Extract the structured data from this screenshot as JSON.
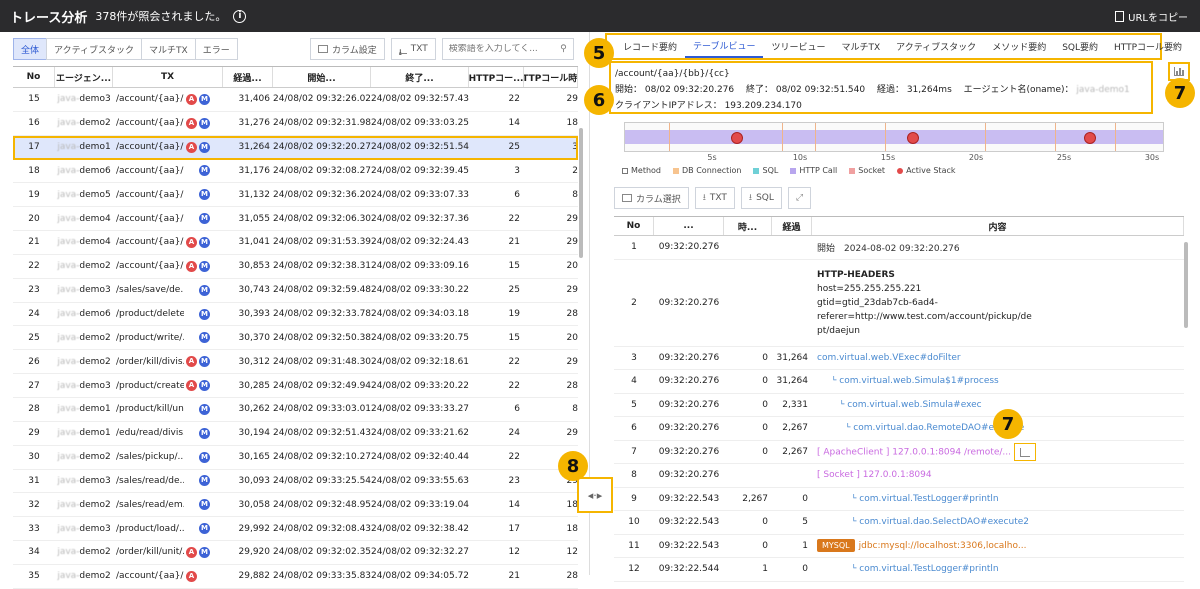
{
  "header": {
    "title": "トレース分析",
    "count_text": "378件が照会されました。",
    "info_icon": "i",
    "copy_label": "URLをコピー"
  },
  "filters": [
    "全体",
    "アクティブスタック",
    "マルチTX",
    "エラー"
  ],
  "left_tools": {
    "column_settings": "カラム設定",
    "txt": "TXT",
    "search_placeholder": "検索語を入力してく..."
  },
  "columns": [
    "No",
    "エージェン...",
    "TX",
    "経過...",
    "開始...",
    "終了...",
    "HTTPコー...",
    "HTTPコール時間"
  ],
  "rows": [
    {
      "no": "15",
      "agent": "demo3",
      "tx": "/account/{aa}/{...",
      "a": true,
      "m": true,
      "elapsed": "31,406",
      "start": "24/08/02 09:32:26.029",
      "end": "24/08/02 09:32:57.435",
      "hc": "22",
      "ht": "29"
    },
    {
      "no": "16",
      "agent": "demo2",
      "tx": "/account/{aa}/{...",
      "a": true,
      "m": true,
      "elapsed": "31,276",
      "start": "24/08/02 09:32:31.982",
      "end": "24/08/02 09:33:03.258",
      "hc": "14",
      "ht": "18"
    },
    {
      "no": "17",
      "agent": "demo1",
      "tx": "/account/{aa}/{...",
      "a": true,
      "m": true,
      "elapsed": "31,264",
      "start": "24/08/02 09:32:20.276",
      "end": "24/08/02 09:32:51.540",
      "hc": "25",
      "ht": "3"
    },
    {
      "no": "18",
      "agent": "demo6",
      "tx": "/account/{aa}/{...",
      "a": false,
      "m": true,
      "elapsed": "31,176",
      "start": "24/08/02 09:32:08.278",
      "end": "24/08/02 09:32:39.454",
      "hc": "3",
      "ht": "2"
    },
    {
      "no": "19",
      "agent": "demo5",
      "tx": "/account/{aa}/{...",
      "a": false,
      "m": true,
      "elapsed": "31,132",
      "start": "24/08/02 09:32:36.202",
      "end": "24/08/02 09:33:07.334",
      "hc": "6",
      "ht": "8"
    },
    {
      "no": "20",
      "agent": "demo4",
      "tx": "/account/{aa}/{...",
      "a": false,
      "m": true,
      "elapsed": "31,055",
      "start": "24/08/02 09:32:06.308",
      "end": "24/08/02 09:32:37.363",
      "hc": "22",
      "ht": "29"
    },
    {
      "no": "21",
      "agent": "demo4",
      "tx": "/account/{aa}/{...",
      "a": true,
      "m": true,
      "elapsed": "31,041",
      "start": "24/08/02 09:31:53.398",
      "end": "24/08/02 09:32:24.439",
      "hc": "21",
      "ht": "29"
    },
    {
      "no": "22",
      "agent": "demo2",
      "tx": "/account/{aa}/{...",
      "a": true,
      "m": true,
      "elapsed": "30,853",
      "start": "24/08/02 09:32:38.313",
      "end": "24/08/02 09:33:09.166",
      "hc": "15",
      "ht": "20"
    },
    {
      "no": "23",
      "agent": "demo3",
      "tx": "/sales/save/de...",
      "a": false,
      "m": true,
      "elapsed": "30,743",
      "start": "24/08/02 09:32:59.481",
      "end": "24/08/02 09:33:30.224",
      "hc": "25",
      "ht": "29"
    },
    {
      "no": "24",
      "agent": "demo6",
      "tx": "/product/delete...",
      "a": false,
      "m": true,
      "elapsed": "30,393",
      "start": "24/08/02 09:32:33.787",
      "end": "24/08/02 09:34:03.180",
      "hc": "19",
      "ht": "28"
    },
    {
      "no": "25",
      "agent": "demo2",
      "tx": "/product/write/...",
      "a": false,
      "m": true,
      "elapsed": "30,370",
      "start": "24/08/02 09:32:50.389",
      "end": "24/08/02 09:33:20.759",
      "hc": "15",
      "ht": "20"
    },
    {
      "no": "26",
      "agent": "demo2",
      "tx": "/order/kill/divis...",
      "a": true,
      "m": true,
      "elapsed": "30,312",
      "start": "24/08/02 09:31:48.304",
      "end": "24/08/02 09:32:18.616",
      "hc": "22",
      "ht": "29"
    },
    {
      "no": "27",
      "agent": "demo3",
      "tx": "/product/create...",
      "a": true,
      "m": true,
      "elapsed": "30,285",
      "start": "24/08/02 09:32:49.944",
      "end": "24/08/02 09:33:20.229",
      "hc": "22",
      "ht": "28"
    },
    {
      "no": "28",
      "agent": "demo1",
      "tx": "/product/kill/un...",
      "a": false,
      "m": true,
      "elapsed": "30,262",
      "start": "24/08/02 09:33:03.011",
      "end": "24/08/02 09:33:33.273",
      "hc": "6",
      "ht": "8"
    },
    {
      "no": "29",
      "agent": "demo1",
      "tx": "/edu/read/divis...",
      "a": false,
      "m": true,
      "elapsed": "30,194",
      "start": "24/08/02 09:32:51.435",
      "end": "24/08/02 09:33:21.629",
      "hc": "24",
      "ht": "29"
    },
    {
      "no": "30",
      "agent": "demo2",
      "tx": "/sales/pickup/...",
      "a": false,
      "m": true,
      "elapsed": "30,165",
      "start": "24/08/02 09:32:10.276",
      "end": "24/08/02 09:32:40.441",
      "hc": "22",
      "ht": "29"
    },
    {
      "no": "31",
      "agent": "demo3",
      "tx": "/sales/read/de...",
      "a": false,
      "m": true,
      "elapsed": "30,093",
      "start": "24/08/02 09:33:25.545",
      "end": "24/08/02 09:33:55.638",
      "hc": "23",
      "ht": "29"
    },
    {
      "no": "32",
      "agent": "demo2",
      "tx": "/sales/read/em...",
      "a": false,
      "m": true,
      "elapsed": "30,058",
      "start": "24/08/02 09:32:48.950",
      "end": "24/08/02 09:33:19.040",
      "hc": "14",
      "ht": "18"
    },
    {
      "no": "33",
      "agent": "demo3",
      "tx": "/product/load/...",
      "a": false,
      "m": true,
      "elapsed": "29,992",
      "start": "24/08/02 09:32:08.434",
      "end": "24/08/02 09:32:38.426",
      "hc": "17",
      "ht": "18"
    },
    {
      "no": "34",
      "agent": "demo2",
      "tx": "/order/kill/unit/...",
      "a": true,
      "m": true,
      "elapsed": "29,920",
      "start": "24/08/02 09:32:02.357",
      "end": "24/08/02 09:32:32.277",
      "hc": "12",
      "ht": "12"
    },
    {
      "no": "35",
      "agent": "demo2",
      "tx": "/account/{aa}/{...",
      "a": true,
      "m": false,
      "elapsed": "29,882",
      "start": "24/08/02 09:33:35.839",
      "end": "24/08/02 09:34:05.721",
      "hc": "21",
      "ht": "28"
    }
  ],
  "badges": {
    "a": "A",
    "m": "M"
  },
  "right_tabs": [
    "レコード要約",
    "テーブルビュー",
    "ツリービュー",
    "マルチTX",
    "アクティブスタック",
    "メソッド要約",
    "SQL要約",
    "HTTPコール要約"
  ],
  "right_more": "···",
  "summary": {
    "path": "/account/{aa}/{bb}/{cc}",
    "line2": "開始： 08/02 09:32:20.276　 終了： 08/02 09:32:51.540　 経過： 31,264ms　 エージェント名(oname)： ",
    "agent_blur": "java-demo1",
    "line3": "クライアントIPアドレス： 193.209.234.170"
  },
  "axis_ticks": [
    "5s",
    "10s",
    "15s",
    "20s",
    "25s",
    "30s"
  ],
  "legend": [
    {
      "label": "Method",
      "color": "#ffffff"
    },
    {
      "label": "DB Connection",
      "color": "#f7c48f"
    },
    {
      "label": "SQL",
      "color": "#6fd0d6"
    },
    {
      "label": "HTTP Call",
      "color": "#b8a6ee"
    },
    {
      "label": "Socket",
      "color": "#f0a0a0"
    },
    {
      "label": "Active Stack",
      "color": "#e24a4a"
    }
  ],
  "right_tools": {
    "column_select": "カラム選択",
    "txt": "TXT",
    "sql": "SQL"
  },
  "right_columns": [
    "No",
    "...",
    "時...",
    "経過",
    "内容"
  ],
  "right_rows": [
    {
      "no": "1",
      "time": "09:32:20.276",
      "t2": "",
      "el": "",
      "content": "開始　2024-08-02 09:32:20.276",
      "style": "dk"
    },
    {
      "no": "2",
      "time": "09:32:20.276",
      "t2": "",
      "el": "",
      "content": "HTTP-HEADERS",
      "style": "tall"
    },
    {
      "no": "3",
      "time": "09:32:20.276",
      "t2": "0",
      "el": "31,264",
      "content": "com.virtual.web.VExec#doFilter",
      "style": "link"
    },
    {
      "no": "4",
      "time": "09:32:20.276",
      "t2": "0",
      "el": "31,264",
      "content": "└ com.virtual.web.Simula$1#process",
      "style": "link"
    },
    {
      "no": "5",
      "time": "09:32:20.276",
      "t2": "0",
      "el": "2,331",
      "content": "└ com.virtual.web.Simula#exec",
      "style": "link"
    },
    {
      "no": "6",
      "time": "09:32:20.276",
      "t2": "0",
      "el": "2,267",
      "content": "└ com.virtual.dao.RemoteDAO#execute",
      "style": "link"
    },
    {
      "no": "7",
      "time": "09:32:20.276",
      "t2": "0",
      "el": "2,267",
      "content": "[ ApacheClient ] 127.0.0.1:8094 /remote/...",
      "style": "kw"
    },
    {
      "no": "8",
      "time": "09:32:20.276",
      "t2": "",
      "el": "",
      "content": "[ Socket ] 127.0.0.1:8094",
      "style": "kw"
    },
    {
      "no": "9",
      "time": "09:32:22.543",
      "t2": "2,267",
      "el": "0",
      "content": "└ com.virtual.TestLogger#println",
      "style": "link"
    },
    {
      "no": "10",
      "time": "09:32:22.543",
      "t2": "0",
      "el": "5",
      "content": "└ com.virtual.dao.SelectDAO#execute2",
      "style": "link"
    },
    {
      "no": "11",
      "time": "09:32:22.543",
      "t2": "0",
      "el": "1",
      "content": "jdbc:mysql://localhost:3306,localho...",
      "style": "ora"
    },
    {
      "no": "12",
      "time": "09:32:22.544",
      "t2": "1",
      "el": "0",
      "content": "└ com.virtual.TestLogger#println",
      "style": "link"
    }
  ],
  "http_headers": [
    "host=255.255.255.221",
    "gtid=gtid_23dab7cb-6ad4-",
    "referer=http://www.test.com/account/pickup/de",
    "pt/daejun"
  ],
  "mysql_label": "MYSQL",
  "callouts": {
    "c5": "5",
    "c6": "6",
    "c7": "7",
    "c8": "8"
  },
  "splitter_icon": "◂·▸"
}
